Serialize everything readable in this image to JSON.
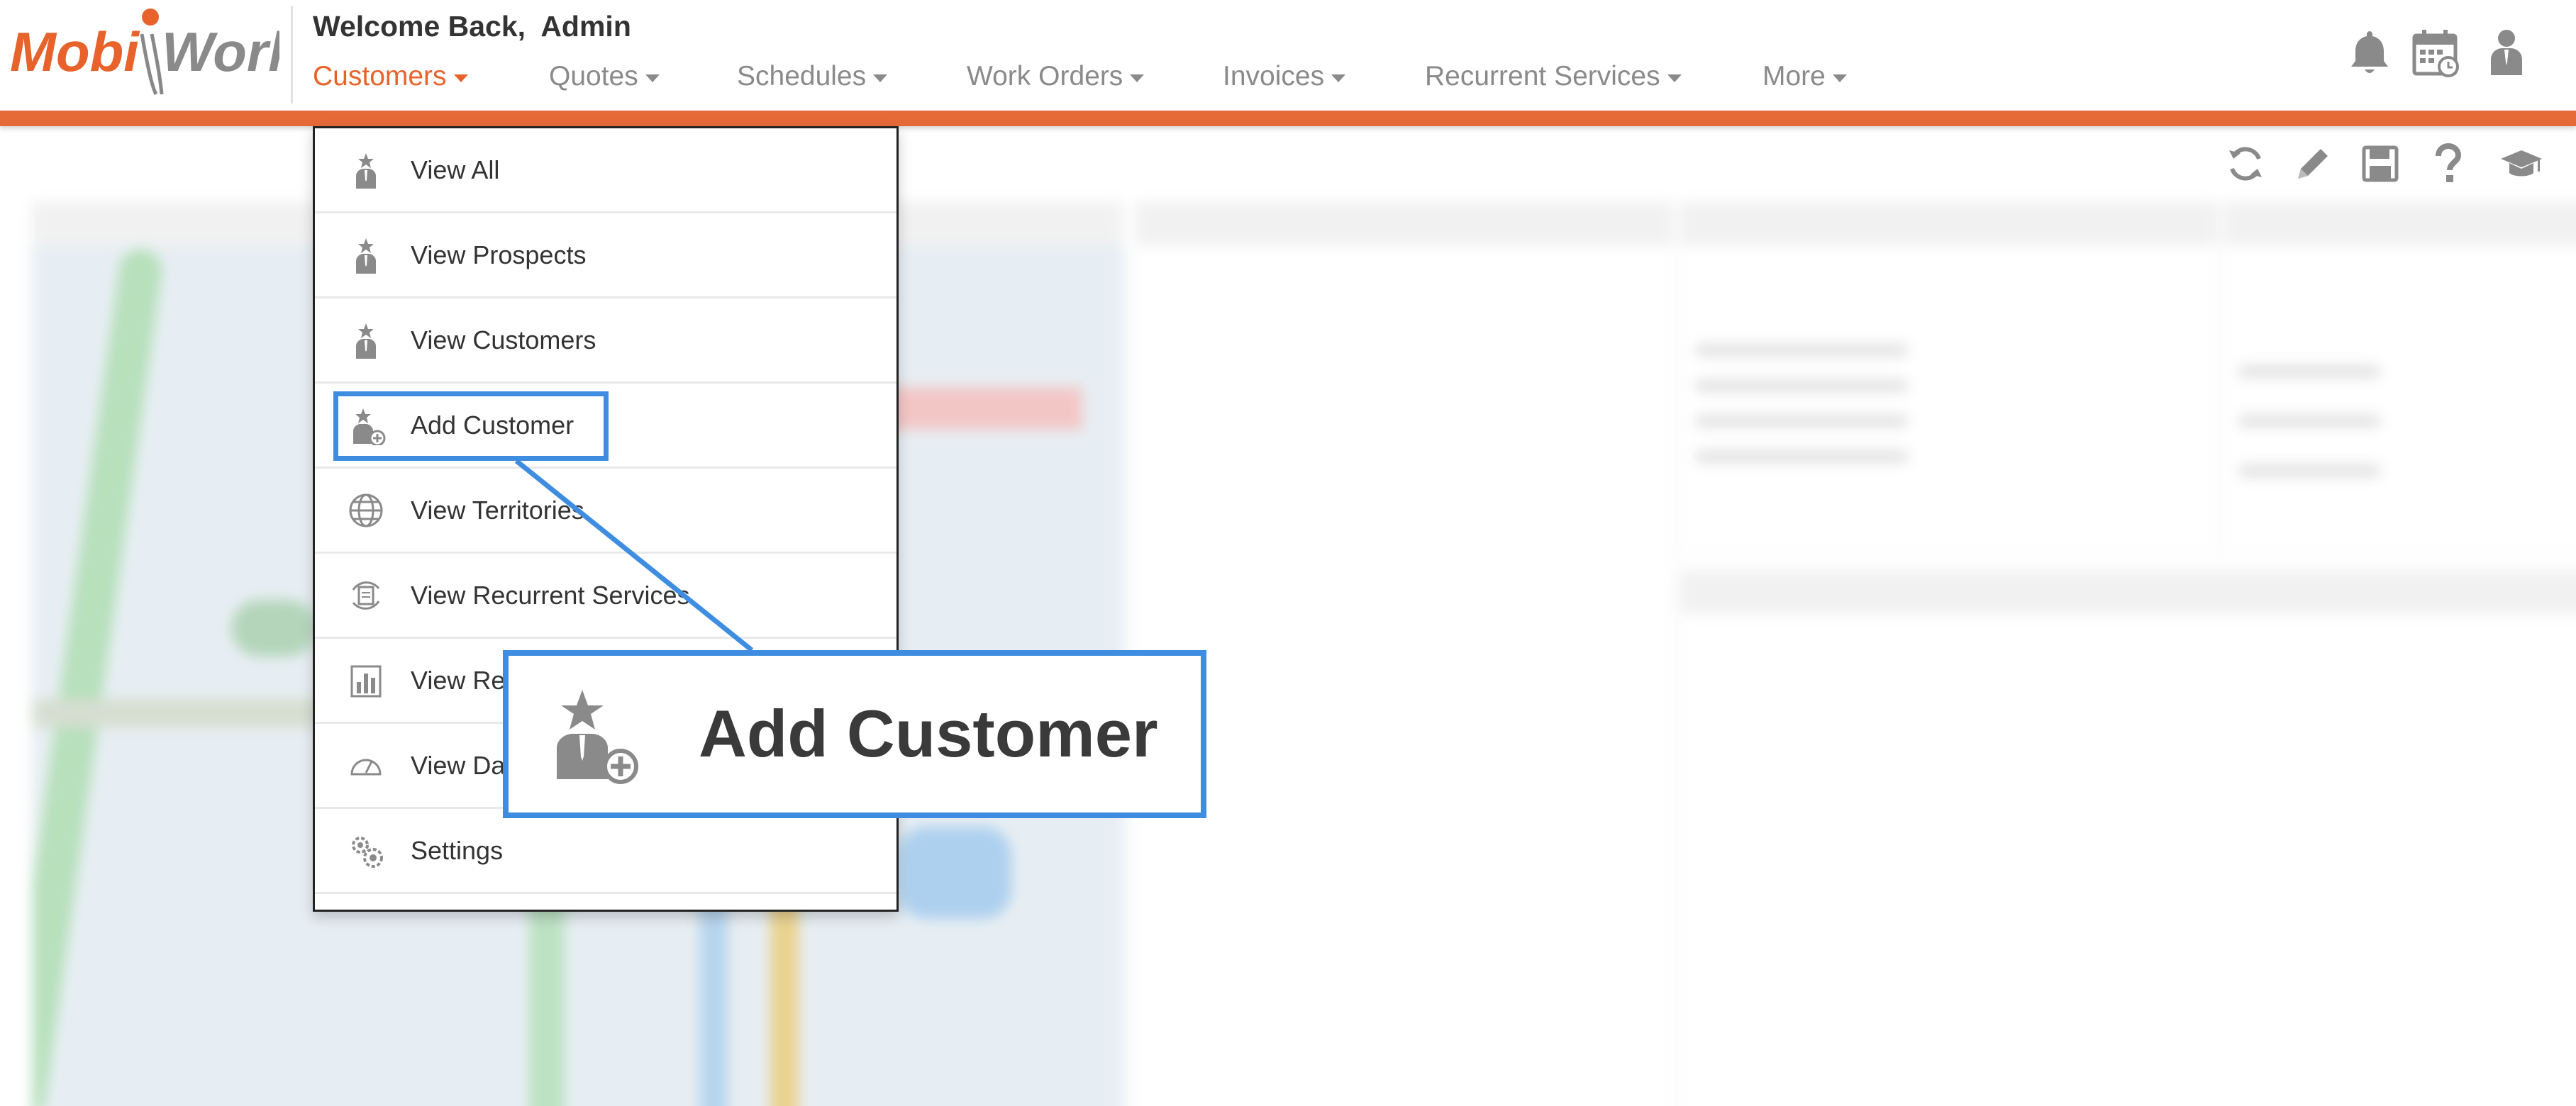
{
  "app": {
    "logo_text": "MobiWork",
    "welcome": "Welcome Back,  Admin"
  },
  "nav": [
    {
      "label": "Customers",
      "active": true
    },
    {
      "label": "Quotes"
    },
    {
      "label": "Schedules"
    },
    {
      "label": "Work Orders"
    },
    {
      "label": "Invoices"
    },
    {
      "label": "Recurrent Services"
    },
    {
      "label": "More"
    }
  ],
  "header_icons": [
    "bell-icon",
    "calendar-icon",
    "user-icon"
  ],
  "toolbar_icons": [
    "refresh-icon",
    "pencil-icon",
    "save-icon",
    "help-icon",
    "graduation-cap-icon"
  ],
  "customers_menu": [
    {
      "label": "View All",
      "icon": "customer-icon"
    },
    {
      "label": "View Prospects",
      "icon": "customer-icon"
    },
    {
      "label": "View Customers",
      "icon": "customer-icon"
    },
    {
      "label": "Add Customer",
      "icon": "add-customer-icon",
      "highlighted": true
    },
    {
      "label": "View Territories",
      "icon": "globe-icon"
    },
    {
      "label": "View Recurrent Services",
      "icon": "recurrent-icon"
    },
    {
      "label": "View Re",
      "icon": "bar-chart-icon"
    },
    {
      "label": "View Da",
      "icon": "dashboard-gauge-icon"
    },
    {
      "label": "Settings",
      "icon": "gears-icon"
    }
  ],
  "callout": {
    "label": "Add Customer",
    "icon": "add-customer-icon"
  },
  "colors": {
    "brand_orange": "#e8622b",
    "highlight_blue": "#3f8de0",
    "nav_gray": "#8a8a8a",
    "text_dark": "#333333"
  }
}
